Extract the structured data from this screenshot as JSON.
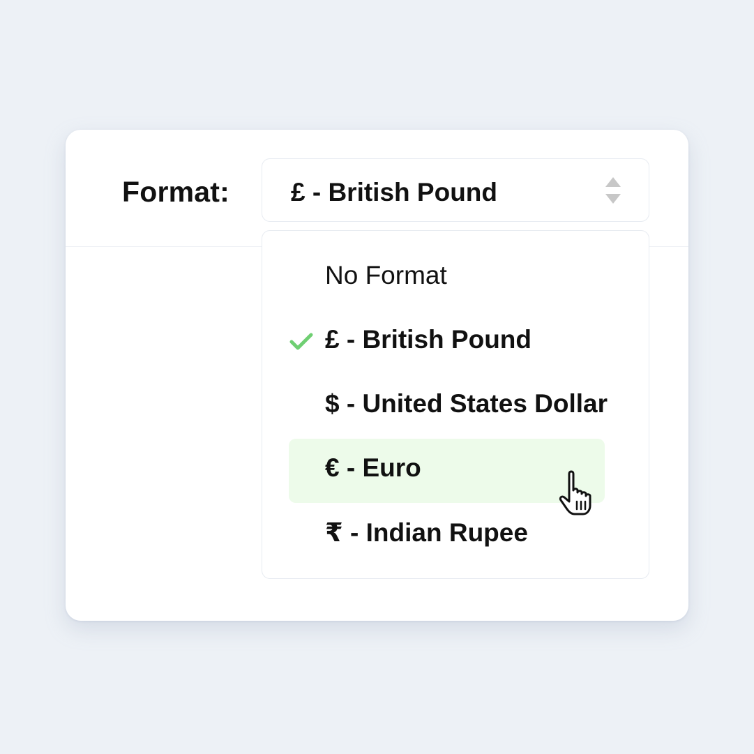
{
  "form": {
    "label": "Format:",
    "selected_value": "£ - British Pound"
  },
  "dropdown": {
    "options": [
      {
        "label": "No Format",
        "selected": false,
        "hovered": false
      },
      {
        "label": "£ - British Pound",
        "selected": true,
        "hovered": false
      },
      {
        "label": "$ - United States Dollar",
        "selected": false,
        "hovered": false
      },
      {
        "label": "€ - Euro",
        "selected": false,
        "hovered": true
      },
      {
        "label": "₹ - Indian Rupee",
        "selected": false,
        "hovered": false
      }
    ]
  },
  "icons": {
    "select_arrows": "sort-arrows-icon",
    "selected_marker": "check-icon",
    "pointer": "hand-pointer-icon"
  },
  "colors": {
    "check": "#6fcf72",
    "hover_background": "#edfbea",
    "page_background": "#edf1f6"
  }
}
